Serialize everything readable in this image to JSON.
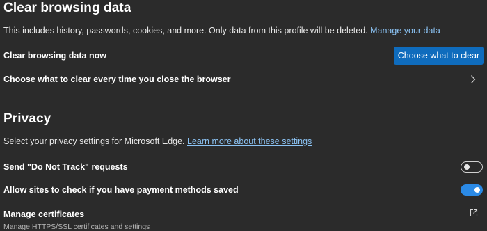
{
  "clear_section": {
    "title": "Clear browsing data",
    "description": "This includes history, passwords, cookies, and more. Only data from this profile will be deleted.",
    "link": "Manage your data",
    "now_label": "Clear browsing data now",
    "button_label": "Choose what to clear",
    "on_close_label": "Choose what to clear every time you close the browser"
  },
  "privacy_section": {
    "title": "Privacy",
    "description": "Select your privacy settings for Microsoft Edge.",
    "link": "Learn more about these settings",
    "settings": [
      {
        "label": "Send \"Do Not Track\" requests",
        "enabled": false
      },
      {
        "label": "Allow sites to check if you have payment methods saved",
        "enabled": true
      }
    ],
    "certificates": {
      "label": "Manage certificates",
      "sublabel": "Manage HTTPS/SSL certificates and settings"
    }
  },
  "colors": {
    "background": "#2b2b2b",
    "accent": "#0f6cbd",
    "link": "#8cc4f5",
    "toggle_on": "#2b8ae6"
  },
  "icons": {
    "chevron": "chevron-right-icon",
    "external": "external-link-icon"
  }
}
